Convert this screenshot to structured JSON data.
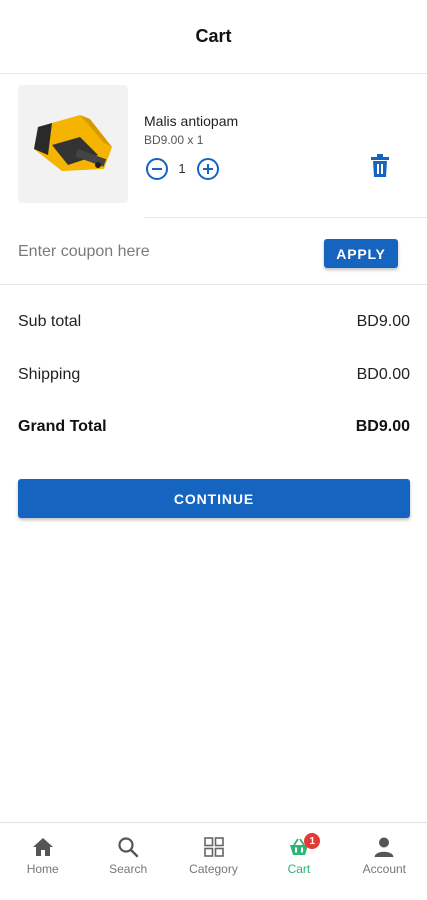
{
  "header": {
    "title": "Cart"
  },
  "item": {
    "name": "Malis antiopam",
    "price_line": "BD9.00 x 1",
    "quantity": "1"
  },
  "coupon": {
    "placeholder": "Enter coupon here",
    "apply_label": "APPLY"
  },
  "summary": {
    "subtotal_label": "Sub total",
    "subtotal_value": "BD9.00",
    "shipping_label": "Shipping",
    "shipping_value": "BD0.00",
    "grand_label": "Grand Total",
    "grand_value": "BD9.00"
  },
  "continue_label": "CONTINUE",
  "nav": {
    "items": [
      {
        "label": "Home",
        "icon": "home-icon"
      },
      {
        "label": "Search",
        "icon": "search-icon"
      },
      {
        "label": "Category",
        "icon": "grid-icon"
      },
      {
        "label": "Cart",
        "icon": "basket-icon",
        "badge": "1"
      },
      {
        "label": "Account",
        "icon": "person-icon"
      }
    ]
  },
  "colors": {
    "primary": "#1565c0",
    "active_nav": "#2bb673",
    "badge": "#e53935"
  }
}
